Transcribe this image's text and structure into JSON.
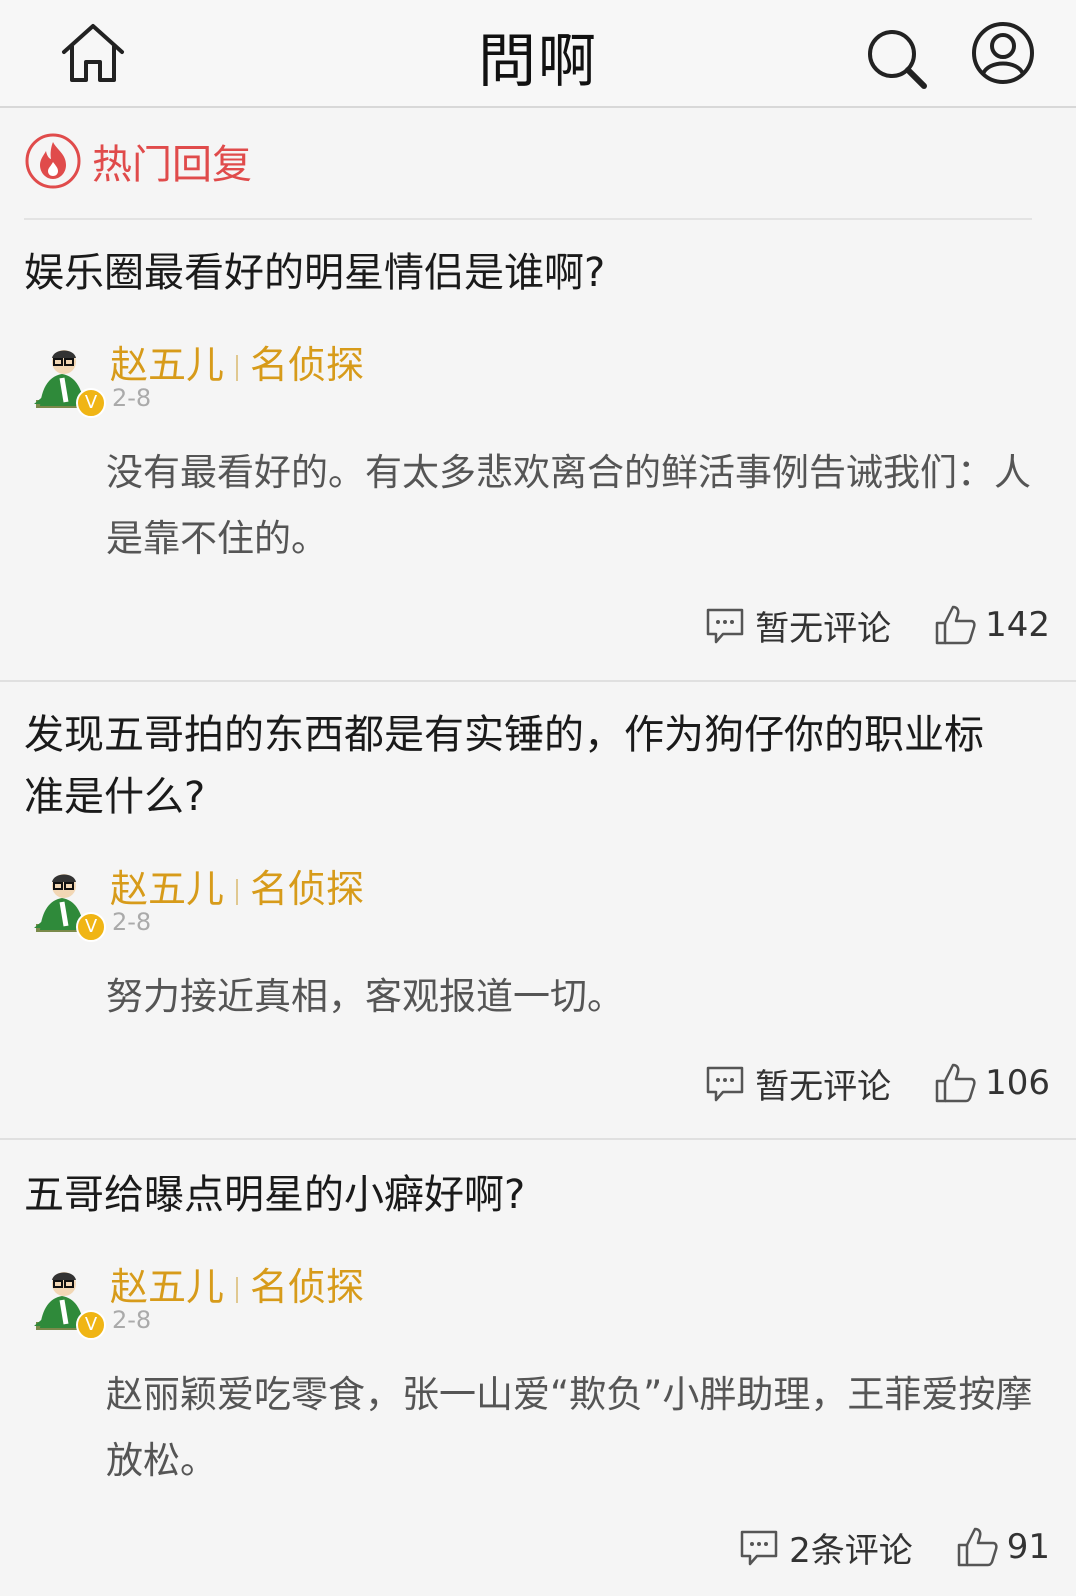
{
  "app": {
    "title": "問啊",
    "home_icon": "home-icon",
    "search_icon": "search-icon",
    "user_icon": "user-icon"
  },
  "section": {
    "label": "热门回复",
    "icon": "fire-icon",
    "color": "#e04b4b"
  },
  "colors": {
    "author": "#d79b1a",
    "badge": "#f0b515"
  },
  "posts": [
    {
      "question": "娱乐圈最看好的明星情侣是谁啊?",
      "author": "赵五儿",
      "author_title": "名侦探",
      "badge": "V",
      "date": "2-8",
      "answer": "没有最看好的。有太多悲欢离合的鲜活事例告诫我们：人是靠不住的。",
      "comments": "暂无评论",
      "likes": "142"
    },
    {
      "question": "发现五哥拍的东西都是有实锤的，作为狗仔你的职业标准是什么?",
      "author": "赵五儿",
      "author_title": "名侦探",
      "badge": "V",
      "date": "2-8",
      "answer": "努力接近真相，客观报道一切。",
      "comments": "暂无评论",
      "likes": "106"
    },
    {
      "question": "五哥给曝点明星的小癖好啊?",
      "author": "赵五儿",
      "author_title": "名侦探",
      "badge": "V",
      "date": "2-8",
      "answer": "赵丽颖爱吃零食，张一山爱“欺负”小胖助理，王菲爱按摩放松。",
      "comments": "2条评论",
      "likes": "91"
    }
  ]
}
